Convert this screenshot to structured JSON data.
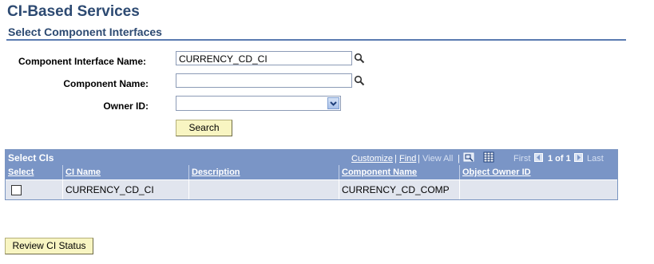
{
  "header": {
    "title": "CI-Based Services",
    "section_title": "Select Component Interfaces"
  },
  "form": {
    "ci_name_label": "Component Interface Name:",
    "ci_name_value": "CURRENCY_CD_CI",
    "component_name_label": "Component Name:",
    "component_name_value": "",
    "owner_id_label": "Owner ID:",
    "owner_id_value": "",
    "search_label": "Search"
  },
  "grid": {
    "title": "Select CIs",
    "customize": "Customize",
    "sep1": "|",
    "find": "Find",
    "sep2": "|",
    "view_all": "View All",
    "sep3": "|",
    "first": "First",
    "page_info": "1 of 1",
    "last": "Last",
    "columns": [
      "Select",
      "CI Name",
      "Description",
      "Component Name",
      "Object Owner ID"
    ],
    "rows": [
      {
        "ci_name": "CURRENCY_CD_CI",
        "description": "",
        "component_name": "CURRENCY_CD_COMP",
        "owner_id": ""
      }
    ]
  },
  "footer": {
    "review_label": "Review CI Status"
  },
  "icons": {
    "lookup": "magnifier-icon",
    "zoom": "zoom-grid-icon",
    "download": "download-excel-icon",
    "prev": "arrow-left-icon",
    "next": "arrow-right-icon"
  },
  "colors": {
    "title": "#2d4a72",
    "grid_header": "#7a95c6",
    "row_bg": "#e1e5ee",
    "button_bg": "#f8f5c2"
  }
}
